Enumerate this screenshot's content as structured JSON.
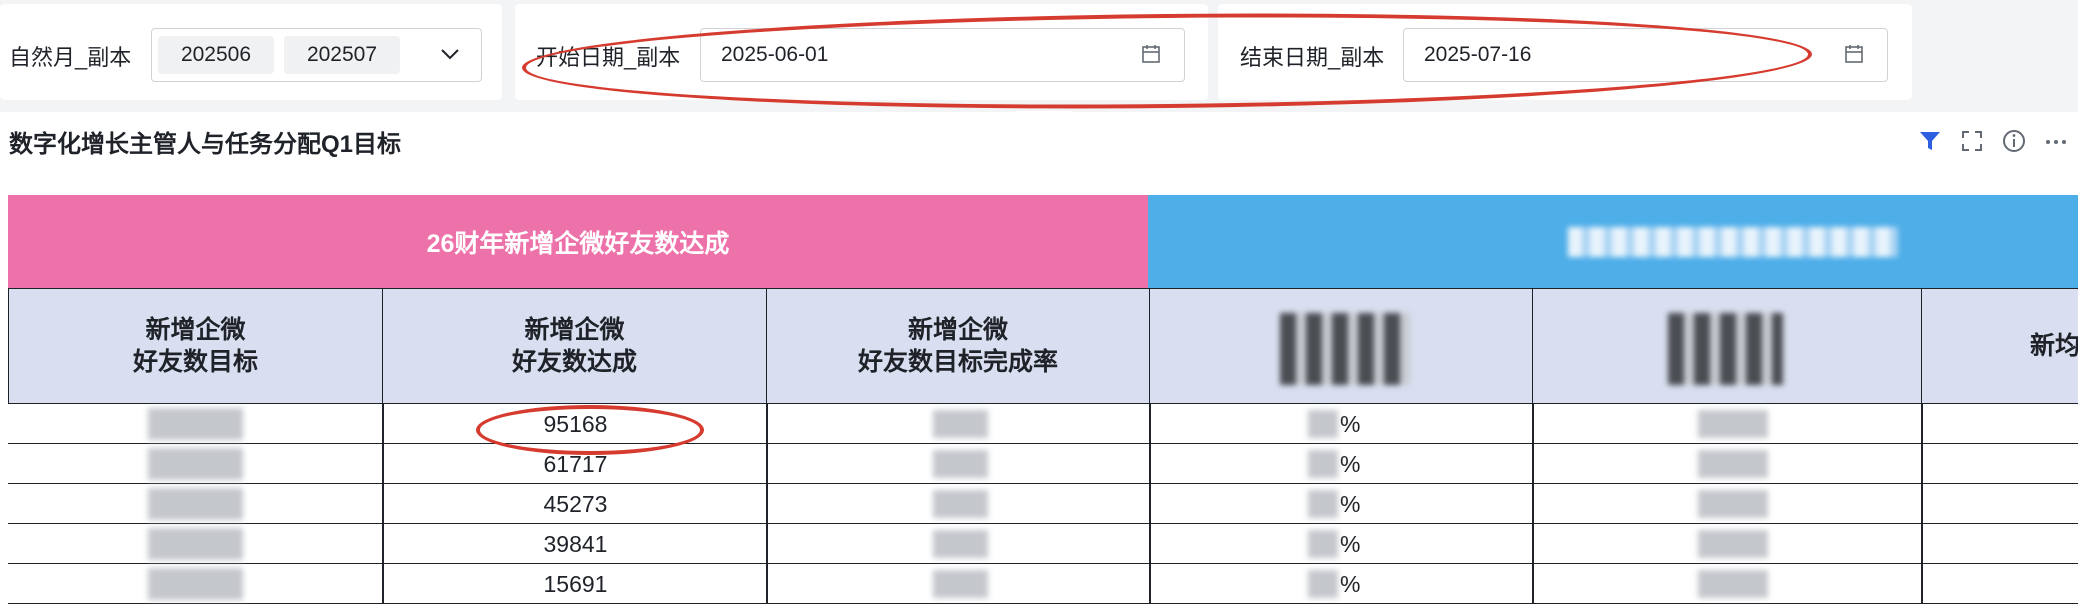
{
  "filters": {
    "month": {
      "label": "自然月_副本",
      "tags": [
        "202506",
        "202507"
      ]
    },
    "start_date": {
      "label": "开始日期_副本",
      "value": "2025-06-01"
    },
    "end_date": {
      "label": "结束日期_副本",
      "value": "2025-07-16"
    }
  },
  "report": {
    "title": "数字化增长主管人与任务分配Q1目标",
    "group_header_pink": "26财年新增企微好友数达成",
    "group_header_pink_color": "#ee72aa",
    "group_header_blue_color": "#4eaee8",
    "header_bg_color": "#d9dff0",
    "columns": [
      {
        "line1": "新增企微",
        "line2": "好友数目标"
      },
      {
        "line1": "新增企微",
        "line2": "好友数达成"
      },
      {
        "line1": "新增企微",
        "line2": "好友数目标完成率"
      }
    ],
    "partial_column": "新均",
    "rows": [
      {
        "achieved": "95168",
        "pct_suffix": "%"
      },
      {
        "achieved": "61717",
        "pct_suffix": "%"
      },
      {
        "achieved": "45273",
        "pct_suffix": "%"
      },
      {
        "achieved": "39841",
        "pct_suffix": "%"
      },
      {
        "achieved": "15691",
        "pct_suffix": "%"
      }
    ]
  },
  "toolbar_icons": [
    "filter-icon",
    "fullscreen-icon",
    "info-icon",
    "more-icon"
  ],
  "annotation_color": "#d63b2f"
}
